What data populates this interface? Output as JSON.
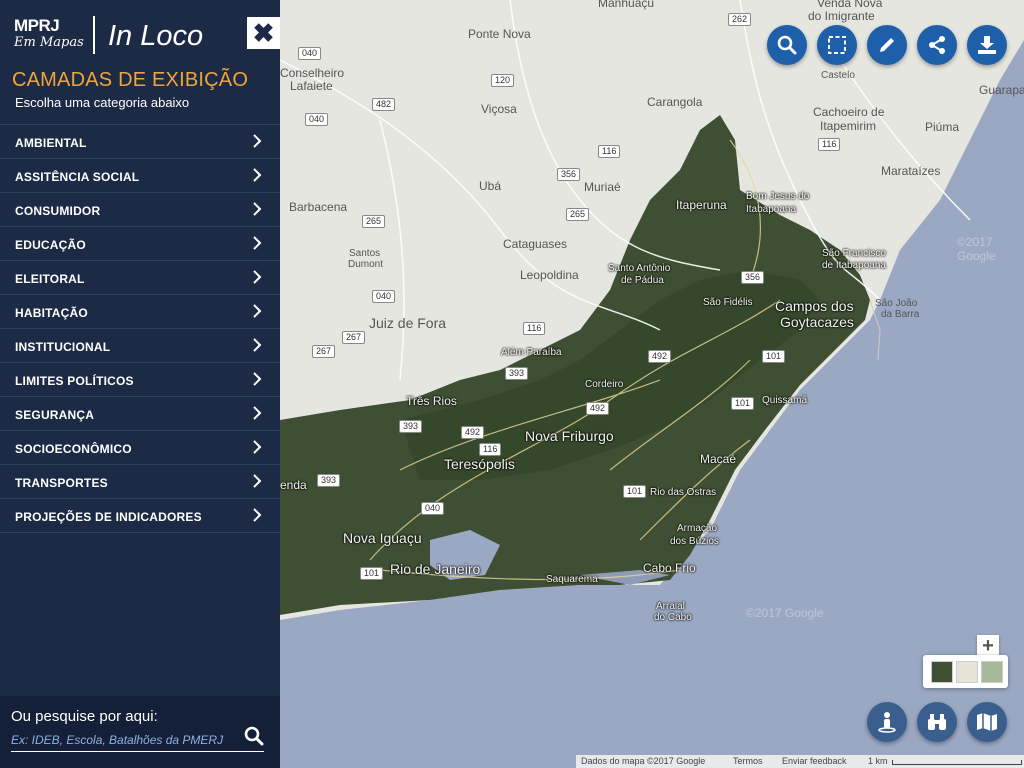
{
  "brand": {
    "org": "MPRJ",
    "product_sub": "Em Mapas",
    "app": "In Loco"
  },
  "sidebar": {
    "title": "CAMADAS DE EXIBIÇÃO",
    "subtitle": "Escolha uma categoria abaixo",
    "close_icon": "close-icon",
    "items": [
      {
        "label": "AMBIENTAL"
      },
      {
        "label": "ASSITÊNCIA SOCIAL"
      },
      {
        "label": "CONSUMIDOR"
      },
      {
        "label": "EDUCAÇÃO"
      },
      {
        "label": "ELEITORAL"
      },
      {
        "label": "HABITAÇÃO"
      },
      {
        "label": "INSTITUCIONAL"
      },
      {
        "label": "LIMITES POLÍTICOS"
      },
      {
        "label": "SEGURANÇA"
      },
      {
        "label": "SOCIOECONÔMICO"
      },
      {
        "label": "TRANSPORTES"
      },
      {
        "label": "PROJEÇÕES DE INDICADORES"
      }
    ],
    "search": {
      "label": "Ou pesquise por aqui:",
      "placeholder": "Ex: IDEB, Escola, Batalhões da PMERJ"
    }
  },
  "toolbar": {
    "buttons": [
      {
        "icon": "search-icon"
      },
      {
        "icon": "select-area-icon"
      },
      {
        "icon": "pencil-icon"
      },
      {
        "icon": "share-icon"
      },
      {
        "icon": "download-icon"
      }
    ],
    "color": "#1d5fa8"
  },
  "map": {
    "zoom_in": "+",
    "attribution": {
      "data": "Dados do mapa ©2017 Google",
      "terms": "Termos",
      "feedback": "Enviar feedback",
      "scale": "1 km"
    },
    "watermark": "©2017 Google",
    "places": {
      "manhuacu": "Manhuaçu",
      "venda_nova": "Venda Nova",
      "do_imigrante": "do Imigrante",
      "conselheiro": "Conselheiro",
      "lafaiete": "Lafaiete",
      "ponte_nova": "Ponte Nova",
      "castelo": "Castelo",
      "guarapari": "Guarapari",
      "vicosa": "Viçosa",
      "carangola": "Carangola",
      "cachoeiro": "Cachoeiro de",
      "itapemirim": "Itapemirim",
      "piuma": "Piúma",
      "uba": "Ubá",
      "muriae": "Muriaé",
      "marataizes": "Marataízes",
      "barbacena": "Barbacena",
      "itaperuna": "Itaperuna",
      "bom_jesus": "Bom Jesus do",
      "itabapoana": "Itabapoana",
      "cataguases": "Cataguases",
      "santos": "Santos",
      "dumont": "Dumont",
      "leopoldina": "Leopoldina",
      "santo_antonio": "Santo Antônio",
      "de_padua": "de Pádua",
      "sao_francisco": "São Francisco",
      "de_itabapoana": "de Itabapoana",
      "sao_fidelis": "São Fidélis",
      "campos": "Campos dos",
      "goytacazes": "Goytacazes",
      "sao_joao": "São João",
      "da_barra": "da Barra",
      "juiz_de_fora": "Juiz de Fora",
      "alem_paraiba": "Além Paraíba",
      "cordeiro": "Cordeiro",
      "tres_rios": "Três Rios",
      "quissama": "Quissamã",
      "nova_friburgo": "Nova Friburgo",
      "teresopolis": "Teresópolis",
      "macae": "Macaé",
      "rio_das_ostras": "Rio das Ostras",
      "armacao": "Armação",
      "dos_buzios": "dos Búzios",
      "nova_iguacu": "Nova Iguaçu",
      "cabo_frio": "Cabo Frio",
      "rio_de_janeiro": "Rio de Janeiro",
      "saquarema": "Saquarema",
      "arraial": "Arraial",
      "do_cabo": "do Cabo",
      "renda": "enda"
    },
    "shields": [
      "262",
      "040",
      "120",
      "482",
      "040",
      "116",
      "356",
      "265",
      "265",
      "116",
      "040",
      "267",
      "267",
      "116",
      "393",
      "492",
      "356",
      "101",
      "101",
      "393",
      "492",
      "116",
      "492",
      "101",
      "393",
      "040",
      "101",
      "101",
      "482",
      "101",
      "393"
    ]
  }
}
